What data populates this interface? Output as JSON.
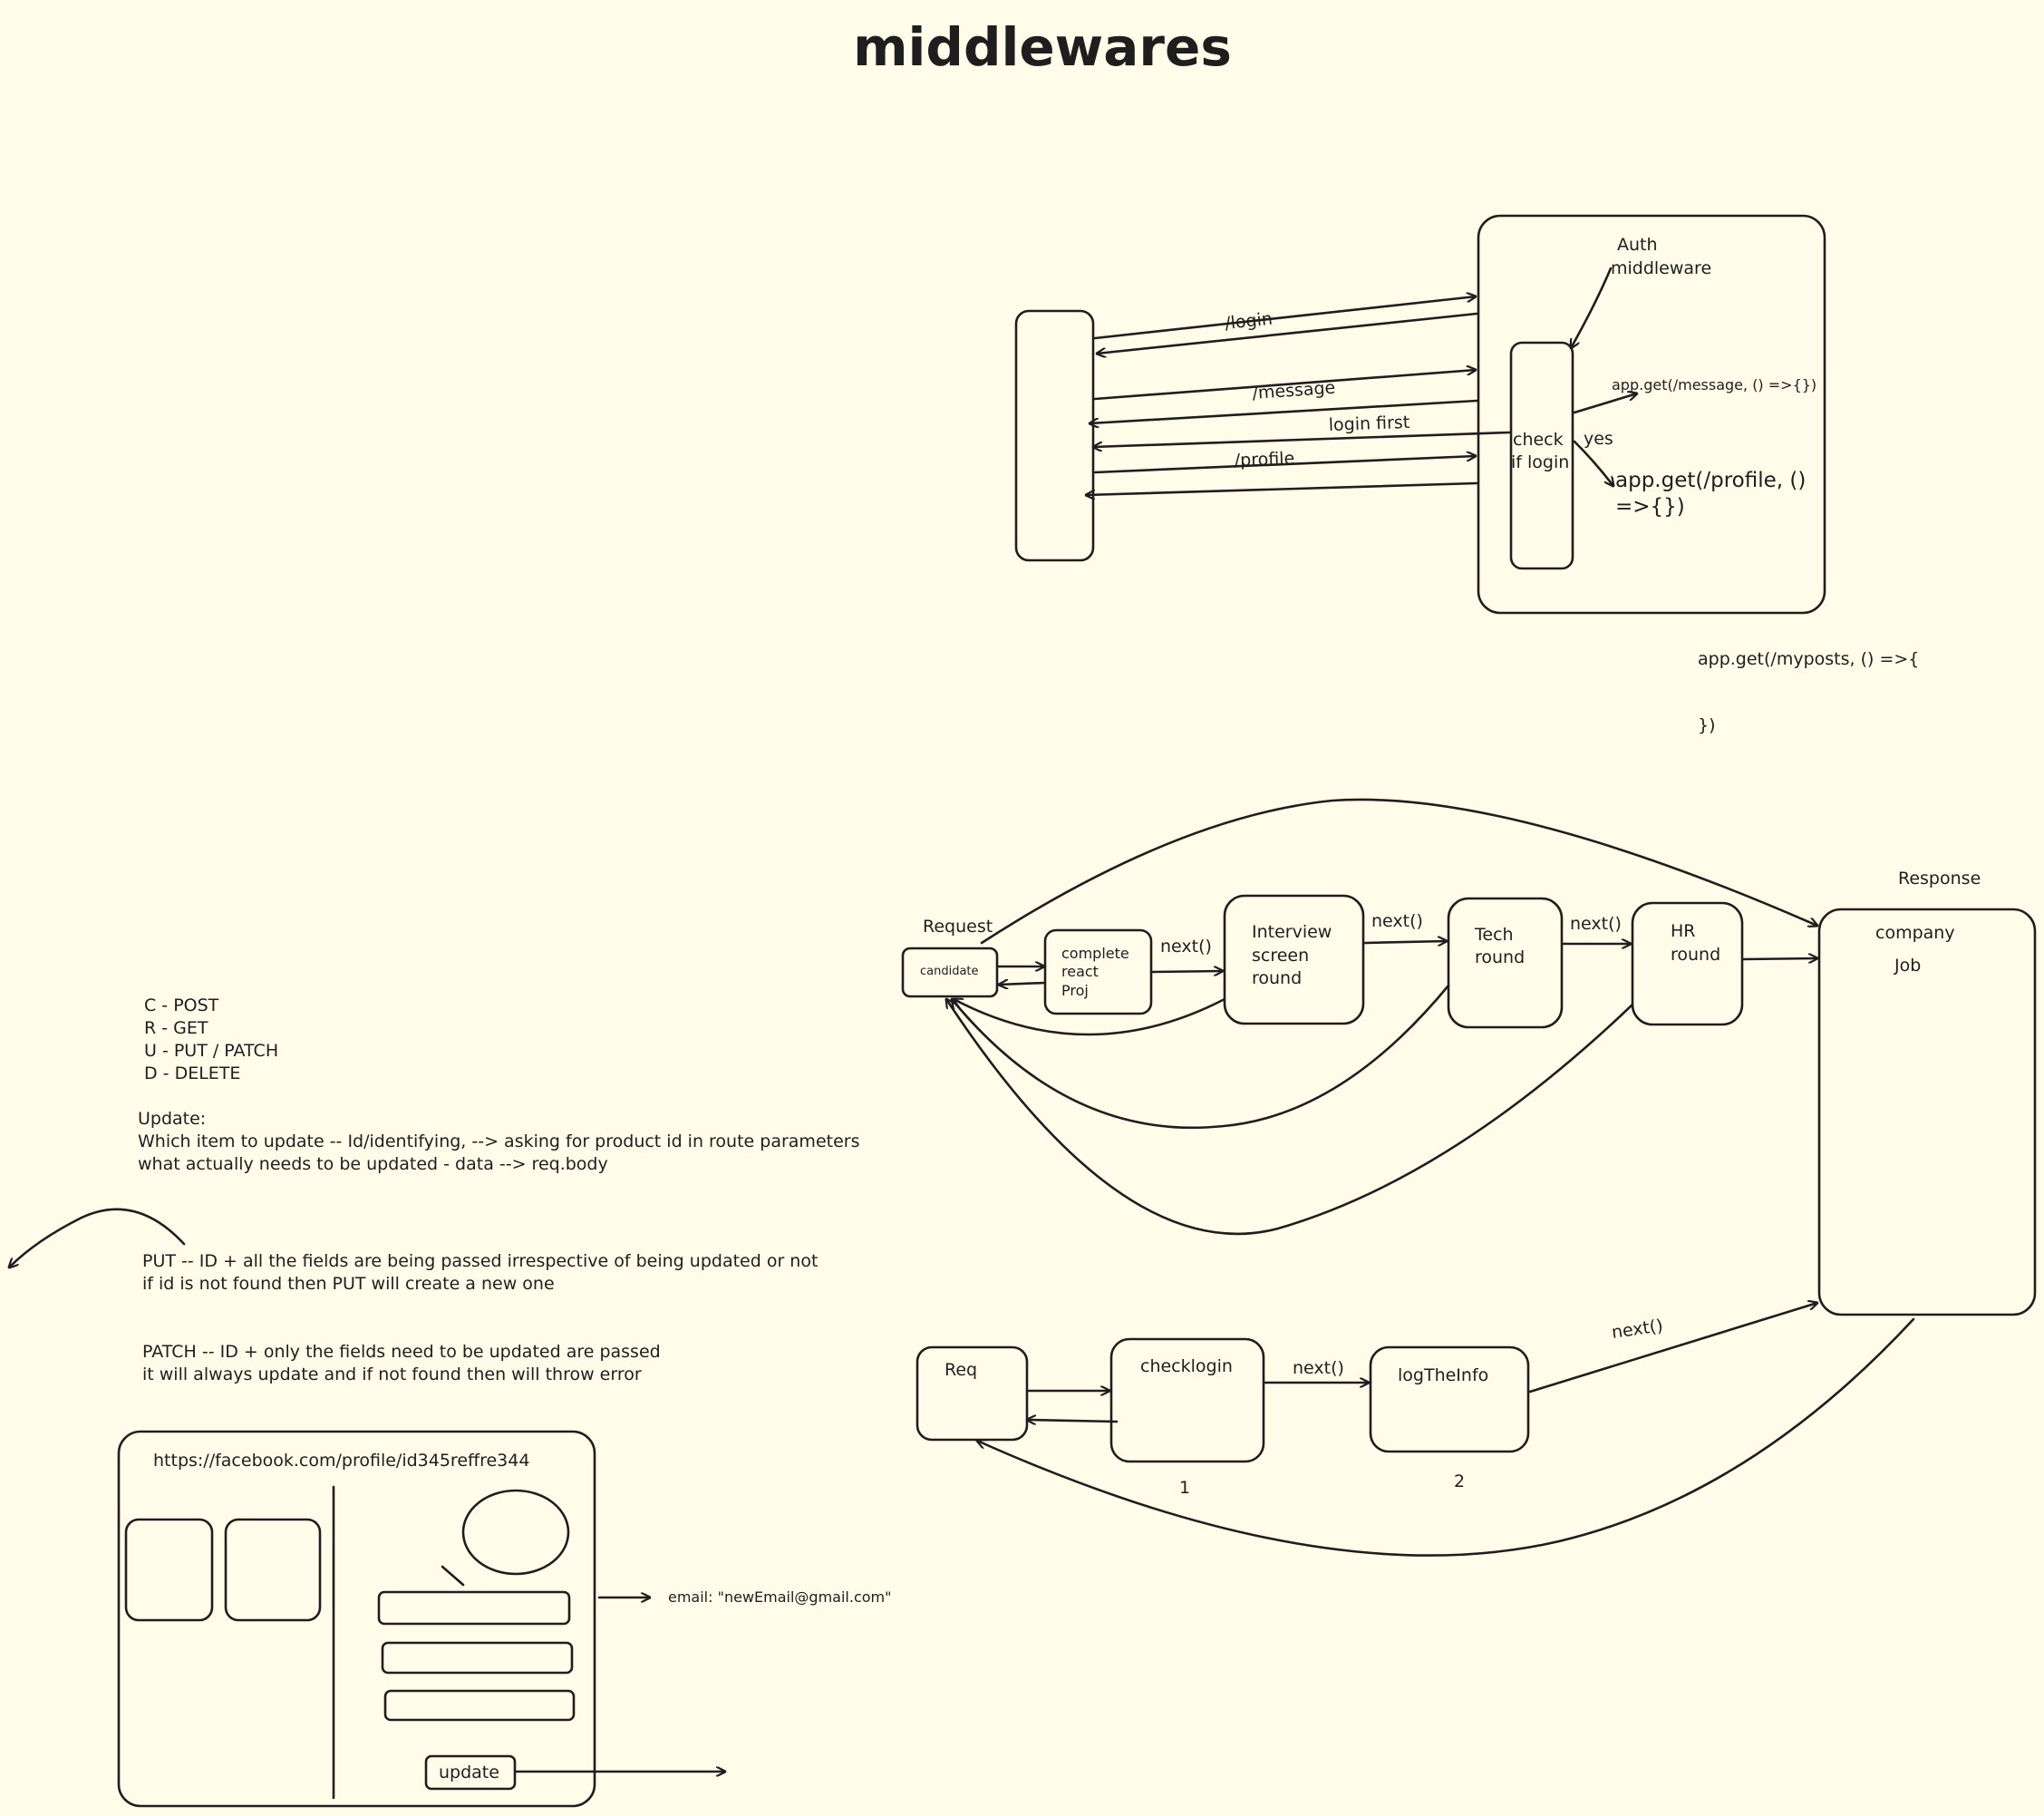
{
  "title": "middlewares",
  "auth": {
    "auth_label": [
      "Auth",
      "middleware"
    ],
    "check_label": [
      "check",
      "if login"
    ],
    "route_login": "/login",
    "route_message": "/message",
    "login_first": "login first",
    "route_profile": "/profile",
    "yes": "yes",
    "msg_handler": "app.get(/message, () =>{})",
    "profile_handler": [
      "app.get(/profile, ()",
      "=>{})"
    ],
    "myposts": [
      "app.get(/myposts, () =>{",
      "})"
    ]
  },
  "flow": {
    "request": "Request",
    "response": "Response",
    "candidate": "candidate",
    "project": [
      "complete",
      "react",
      "Proj"
    ],
    "interview": [
      "Interview",
      "screen",
      "round"
    ],
    "tech": [
      "Tech",
      "round"
    ],
    "hr": [
      "HR",
      "round"
    ],
    "company": [
      "company",
      "Job"
    ],
    "next": "next()"
  },
  "flow2": {
    "req": "Req",
    "checklogin": "checklogin",
    "logtheinfo": "logTheInfo",
    "num1": "1",
    "num2": "2",
    "next": "next()"
  },
  "crud": {
    "lines": [
      "C - POST",
      "R - GET",
      "U - PUT / PATCH",
      "D - DELETE"
    ],
    "update_title": "Update:",
    "update_lines": [
      "Which item to update -- Id/identifying, --> asking for product id in route parameters",
      "what actually needs to be updated - data --> req.body"
    ],
    "put_lines": [
      "PUT -- ID + all the fields are being passed irrespective of being updated or not",
      "if id is not found then PUT will create a new one"
    ],
    "patch_lines": [
      "PATCH -- ID +  only the fields need to be updated are passed",
      "it will always update and if not found then will throw error"
    ]
  },
  "mock": {
    "url": "https://facebook.com/profile/id345reffre344",
    "update_button": "update",
    "email": "email: \"newEmail@gmail.com\""
  }
}
